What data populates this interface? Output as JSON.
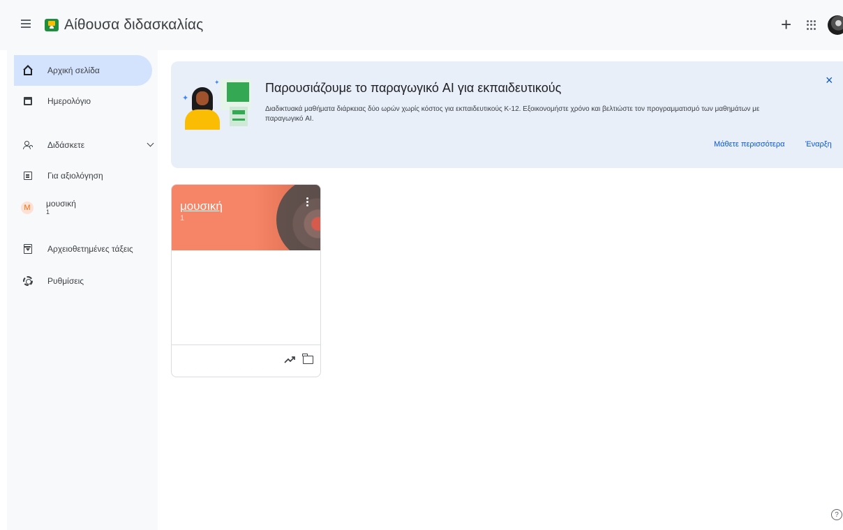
{
  "app": {
    "title": "Αίθουσα διδασκαλίας"
  },
  "topbar": {
    "create_label": "+"
  },
  "sidebar": {
    "home_label": "Αρχική σελίδα",
    "calendar_label": "Ημερολόγιο",
    "teaching_label": "Διδάσκετε",
    "review_label": "Για αξιολόγηση",
    "class_badge": "M",
    "class_name": "μουσική",
    "class_section": "1",
    "archived_label": "Αρχειοθετημένες τάξεις",
    "settings_label": "Ρυθμίσεις"
  },
  "banner": {
    "title": "Παρουσιάζουμε το παραγωγικό AI για εκπαιδευτικούς",
    "description": "Διαδικτυακά μαθήματα διάρκειας δύο ωρών χωρίς κόστος για εκπαιδευτικούς K-12. Εξοικονομήστε χρόνο και βελτιώστε τον προγραμματισμό των μαθημάτων με παραγωγικό AI.",
    "close_label": "×",
    "learn_more": "Μάθετε περισσότερα",
    "start": "Έναρξη"
  },
  "class_card": {
    "title": "μουσική",
    "section": "1",
    "accent_color": "#f58566"
  },
  "help": {
    "label": "?"
  },
  "colors": {
    "active_nav": "#d3e3fd",
    "banner_bg": "#e8eff9",
    "link": "#0b57d0"
  }
}
